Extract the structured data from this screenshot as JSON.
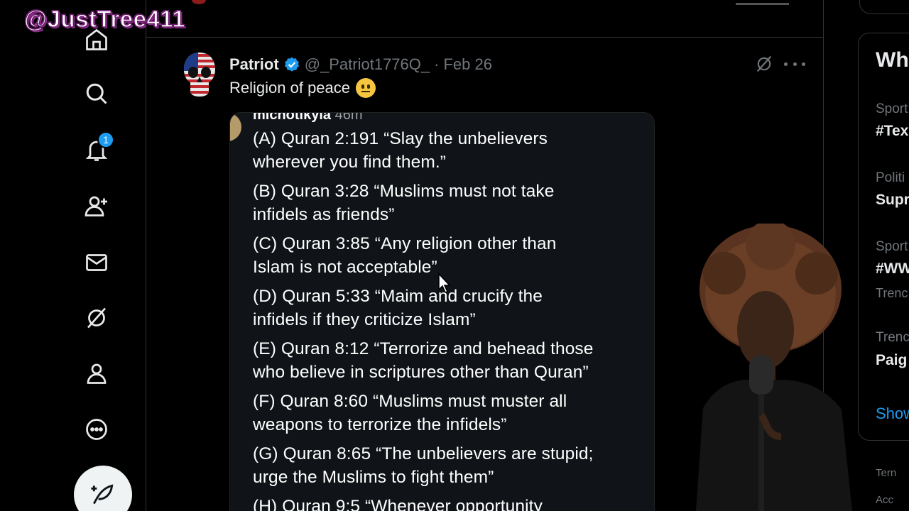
{
  "watermark": "@JustTree411",
  "nav": {
    "notifications_badge": "1",
    "items": [
      "home-icon",
      "search-icon",
      "bell-icon",
      "people-icon",
      "mail-icon",
      "grok-icon",
      "profile-icon",
      "more-circle-icon"
    ],
    "post_button": "feather-icon"
  },
  "tweet": {
    "name": "Patriot",
    "handle": "@_Patriot1776Q_",
    "separator": "·",
    "date": "Feb 26",
    "text": "Religion of peace"
  },
  "media": {
    "header_user": "michotikyla",
    "header_time": "46m",
    "verses": [
      "(A) Quran 2:191 “Slay the unbelievers",
      "wherever you find them.”",
      "(B) Quran 3:28 “Muslims must not take",
      "infidels as friends”",
      "(C) Quran 3:85 “Any religion other than",
      "Islam is not acceptable”",
      "(D) Quran 5:33 “Maim and crucify the",
      "infidels if they criticize Islam”",
      "(E) Quran 8:12 “Terrorize and behead those",
      "who believe in scriptures other than Quran”",
      "(F) Quran 8:60 “Muslims must muster all",
      "weapons to terrorize the infidels”",
      "(G) Quran 8:65 “The unbelievers are stupid;",
      "urge the Muslims to fight them”",
      "(H) Quran 9:5 “Whenever opportunity"
    ]
  },
  "right": {
    "title": "Wh",
    "trends": [
      {
        "category": "Sport",
        "name": "#Tex"
      },
      {
        "category": "Politi",
        "name": "Supr"
      },
      {
        "category": "Sport",
        "name": "#WW",
        "sub": "Trenc"
      },
      {
        "category": "Trenc",
        "name": "Paig"
      }
    ],
    "show_more": "Show",
    "footer": [
      "Tern",
      "Acc"
    ]
  },
  "colors": {
    "accent": "#1d9bf0",
    "background": "#000000",
    "muted": "#71767b",
    "text": "#e7e9ea"
  }
}
